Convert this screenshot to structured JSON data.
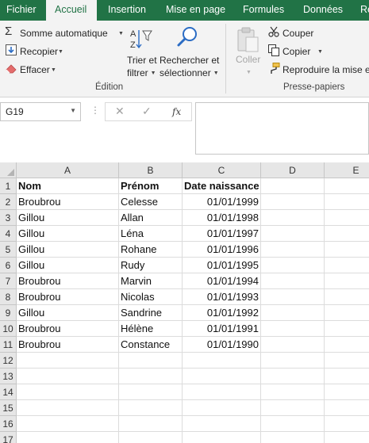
{
  "tabs": [
    {
      "label": "Fichier",
      "active": false
    },
    {
      "label": "Accueil",
      "active": true
    },
    {
      "label": "Insertion",
      "active": false
    },
    {
      "label": "Mise en page",
      "active": false
    },
    {
      "label": "Formules",
      "active": false
    },
    {
      "label": "Données",
      "active": false
    },
    {
      "label": "Re",
      "active": false
    }
  ],
  "ribbon": {
    "edition": {
      "autosum_label": "Somme automatique",
      "fill_label": "Recopier",
      "clear_label": "Effacer",
      "sort_filter_line1": "Trier et",
      "sort_filter_line2": "filtrer",
      "find_select_line1": "Rechercher et",
      "find_select_line2": "sélectionner",
      "group_label": "Édition"
    },
    "clipboard": {
      "paste_label": "Coller",
      "cut_label": "Couper",
      "copy_label": "Copier",
      "format_painter_label": "Reproduire la mise en",
      "group_label": "Presse-papiers"
    }
  },
  "formula_bar": {
    "name_box": "G19",
    "fx_label": "fx",
    "formula": ""
  },
  "columns": [
    "A",
    "B",
    "C",
    "D",
    "E"
  ],
  "rows": [
    {
      "num": "1",
      "cells": [
        "Nom",
        "Prénom",
        "Date naissance",
        "",
        ""
      ]
    },
    {
      "num": "2",
      "cells": [
        "Broubrou",
        "Celesse",
        "01/01/1999",
        "",
        ""
      ]
    },
    {
      "num": "3",
      "cells": [
        "Gillou",
        "Allan",
        "01/01/1998",
        "",
        ""
      ]
    },
    {
      "num": "4",
      "cells": [
        "Gillou",
        "Léna",
        "01/01/1997",
        "",
        ""
      ]
    },
    {
      "num": "5",
      "cells": [
        "Gillou",
        "Rohane",
        "01/01/1996",
        "",
        ""
      ]
    },
    {
      "num": "6",
      "cells": [
        "Gillou",
        "Rudy",
        "01/01/1995",
        "",
        ""
      ]
    },
    {
      "num": "7",
      "cells": [
        "Broubrou",
        "Marvin",
        "01/01/1994",
        "",
        ""
      ]
    },
    {
      "num": "8",
      "cells": [
        "Broubrou",
        "Nicolas",
        "01/01/1993",
        "",
        ""
      ]
    },
    {
      "num": "9",
      "cells": [
        "Gillou",
        "Sandrine",
        "01/01/1992",
        "",
        ""
      ]
    },
    {
      "num": "10",
      "cells": [
        "Broubrou",
        "Hélène",
        "01/01/1991",
        "",
        ""
      ]
    },
    {
      "num": "11",
      "cells": [
        "Broubrou",
        "Constance",
        "01/01/1990",
        "",
        ""
      ]
    },
    {
      "num": "12",
      "cells": [
        "",
        "",
        "",
        "",
        ""
      ]
    },
    {
      "num": "13",
      "cells": [
        "",
        "",
        "",
        "",
        ""
      ]
    },
    {
      "num": "14",
      "cells": [
        "",
        "",
        "",
        "",
        ""
      ]
    },
    {
      "num": "15",
      "cells": [
        "",
        "",
        "",
        "",
        ""
      ]
    },
    {
      "num": "16",
      "cells": [
        "",
        "",
        "",
        "",
        ""
      ]
    },
    {
      "num": "17",
      "cells": [
        "",
        "",
        "",
        "",
        ""
      ]
    }
  ],
  "colors": {
    "excel_green": "#217346",
    "ribbon_bg": "#f3f3f3",
    "header_bg": "#e6e6e6",
    "gridline": "#dcdcdc"
  }
}
